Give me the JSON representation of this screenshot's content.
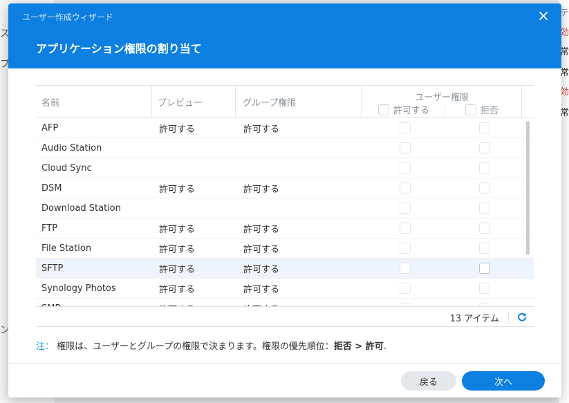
{
  "background": {
    "left_fragments": [
      "ス",
      "プ",
      "ン"
    ],
    "right_fragments": [
      {
        "text": "テ",
        "color": "#888888"
      },
      {
        "text": "効",
        "color": "#e0403a"
      },
      {
        "text": "常",
        "color": "#333333"
      },
      {
        "text": "常",
        "color": "#333333"
      },
      {
        "text": "効",
        "color": "#e0403a"
      },
      {
        "text": "常",
        "color": "#333333"
      }
    ]
  },
  "dialog": {
    "wizard_title": "ユーザー作成ウィザード",
    "step_title": "アプリケーション権限の割り当て",
    "close_icon": "close-icon"
  },
  "table": {
    "headers": {
      "name": "名前",
      "preview": "プレビュー",
      "group": "グループ権限",
      "user_group": "ユーザー権限",
      "allow": "許可する",
      "deny": "拒否"
    },
    "rows": [
      {
        "name": "AFP",
        "preview": "許可する",
        "group": "許可する"
      },
      {
        "name": "Audio Station",
        "preview": "",
        "group": ""
      },
      {
        "name": "Cloud Sync",
        "preview": "",
        "group": ""
      },
      {
        "name": "DSM",
        "preview": "許可する",
        "group": "許可する"
      },
      {
        "name": "Download Station",
        "preview": "",
        "group": ""
      },
      {
        "name": "FTP",
        "preview": "許可する",
        "group": "許可する"
      },
      {
        "name": "File Station",
        "preview": "許可する",
        "group": "許可する"
      },
      {
        "name": "SFTP",
        "preview": "許可する",
        "group": "許可する"
      },
      {
        "name": "Synology Photos",
        "preview": "許可する",
        "group": "許可する"
      },
      {
        "name": "SMB",
        "preview": "許可する",
        "group": "許可する"
      }
    ],
    "selected_row": "SFTP",
    "item_count": "13 アイテム",
    "refresh_icon": "refresh-icon"
  },
  "note": {
    "label": "注：",
    "text": "権限は、ユーザーとグループの権限で決まります。権限の優先順位：",
    "deny": "拒否",
    "gt": " > ",
    "allow": "許可",
    "end": "."
  },
  "buttons": {
    "back": "戻る",
    "next": "次へ"
  },
  "colors": {
    "accent": "#0d7fe0",
    "note_label": "#1f9bd1",
    "selected_row": "#eef4fb"
  }
}
